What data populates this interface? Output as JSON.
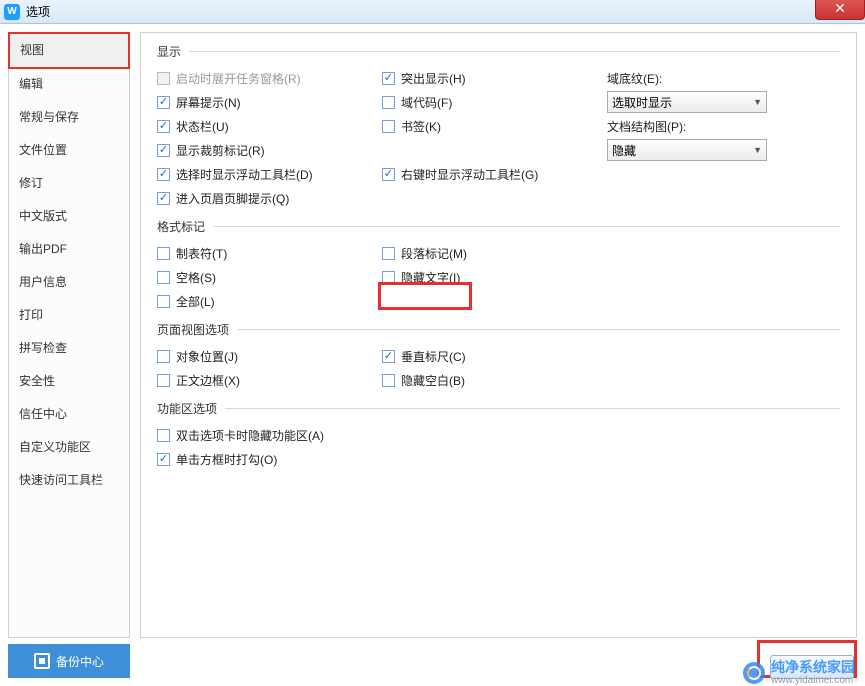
{
  "window": {
    "title": "选项"
  },
  "sidebar": {
    "items": [
      "视图",
      "编辑",
      "常规与保存",
      "文件位置",
      "修订",
      "中文版式",
      "输出PDF",
      "用户信息",
      "打印",
      "拼写检查",
      "安全性",
      "信任中心",
      "自定义功能区",
      "快速访问工具栏"
    ]
  },
  "backup_button": "备份中心",
  "sections": {
    "display": {
      "legend": "显示",
      "c1": {
        "startup_pane": "启动时展开任务窗格(R)",
        "screen_tips": "屏幕提示(N)",
        "status_bar": "状态栏(U)",
        "crop_marks": "显示裁剪标记(R)",
        "float_toolbar_sel": "选择时显示浮动工具栏(D)",
        "header_footer_hint": "进入页眉页脚提示(Q)"
      },
      "c2": {
        "highlight": "突出显示(H)",
        "field_codes": "域代码(F)",
        "bookmarks": "书签(K)",
        "float_toolbar_rc": "右键时显示浮动工具栏(G)"
      },
      "c3": {
        "field_shading_label": "域底纹(E):",
        "field_shading_value": "选取时显示",
        "doc_map_label": "文档结构图(P):",
        "doc_map_value": "隐藏"
      }
    },
    "format_marks": {
      "legend": "格式标记",
      "c1": {
        "tabs": "制表符(T)",
        "spaces": "空格(S)",
        "all": "全部(L)"
      },
      "c2": {
        "para": "段落标记(M)",
        "hidden_text": "隐藏文字(I)"
      }
    },
    "page_view": {
      "legend": "页面视图选项",
      "c1": {
        "obj_pos": "对象位置(J)",
        "text_bounds": "正文边框(X)"
      },
      "c2": {
        "v_ruler": "垂直标尺(C)",
        "hide_blank": "隐藏空白(B)"
      }
    },
    "ribbon": {
      "legend": "功能区选项",
      "dbl_click_hide": "双击选项卡时隐藏功能区(A)",
      "click_check": "单击方框时打勾(O)"
    }
  },
  "watermark": {
    "line1": "纯净系统家园",
    "line2": "www.yidaimei.com"
  }
}
